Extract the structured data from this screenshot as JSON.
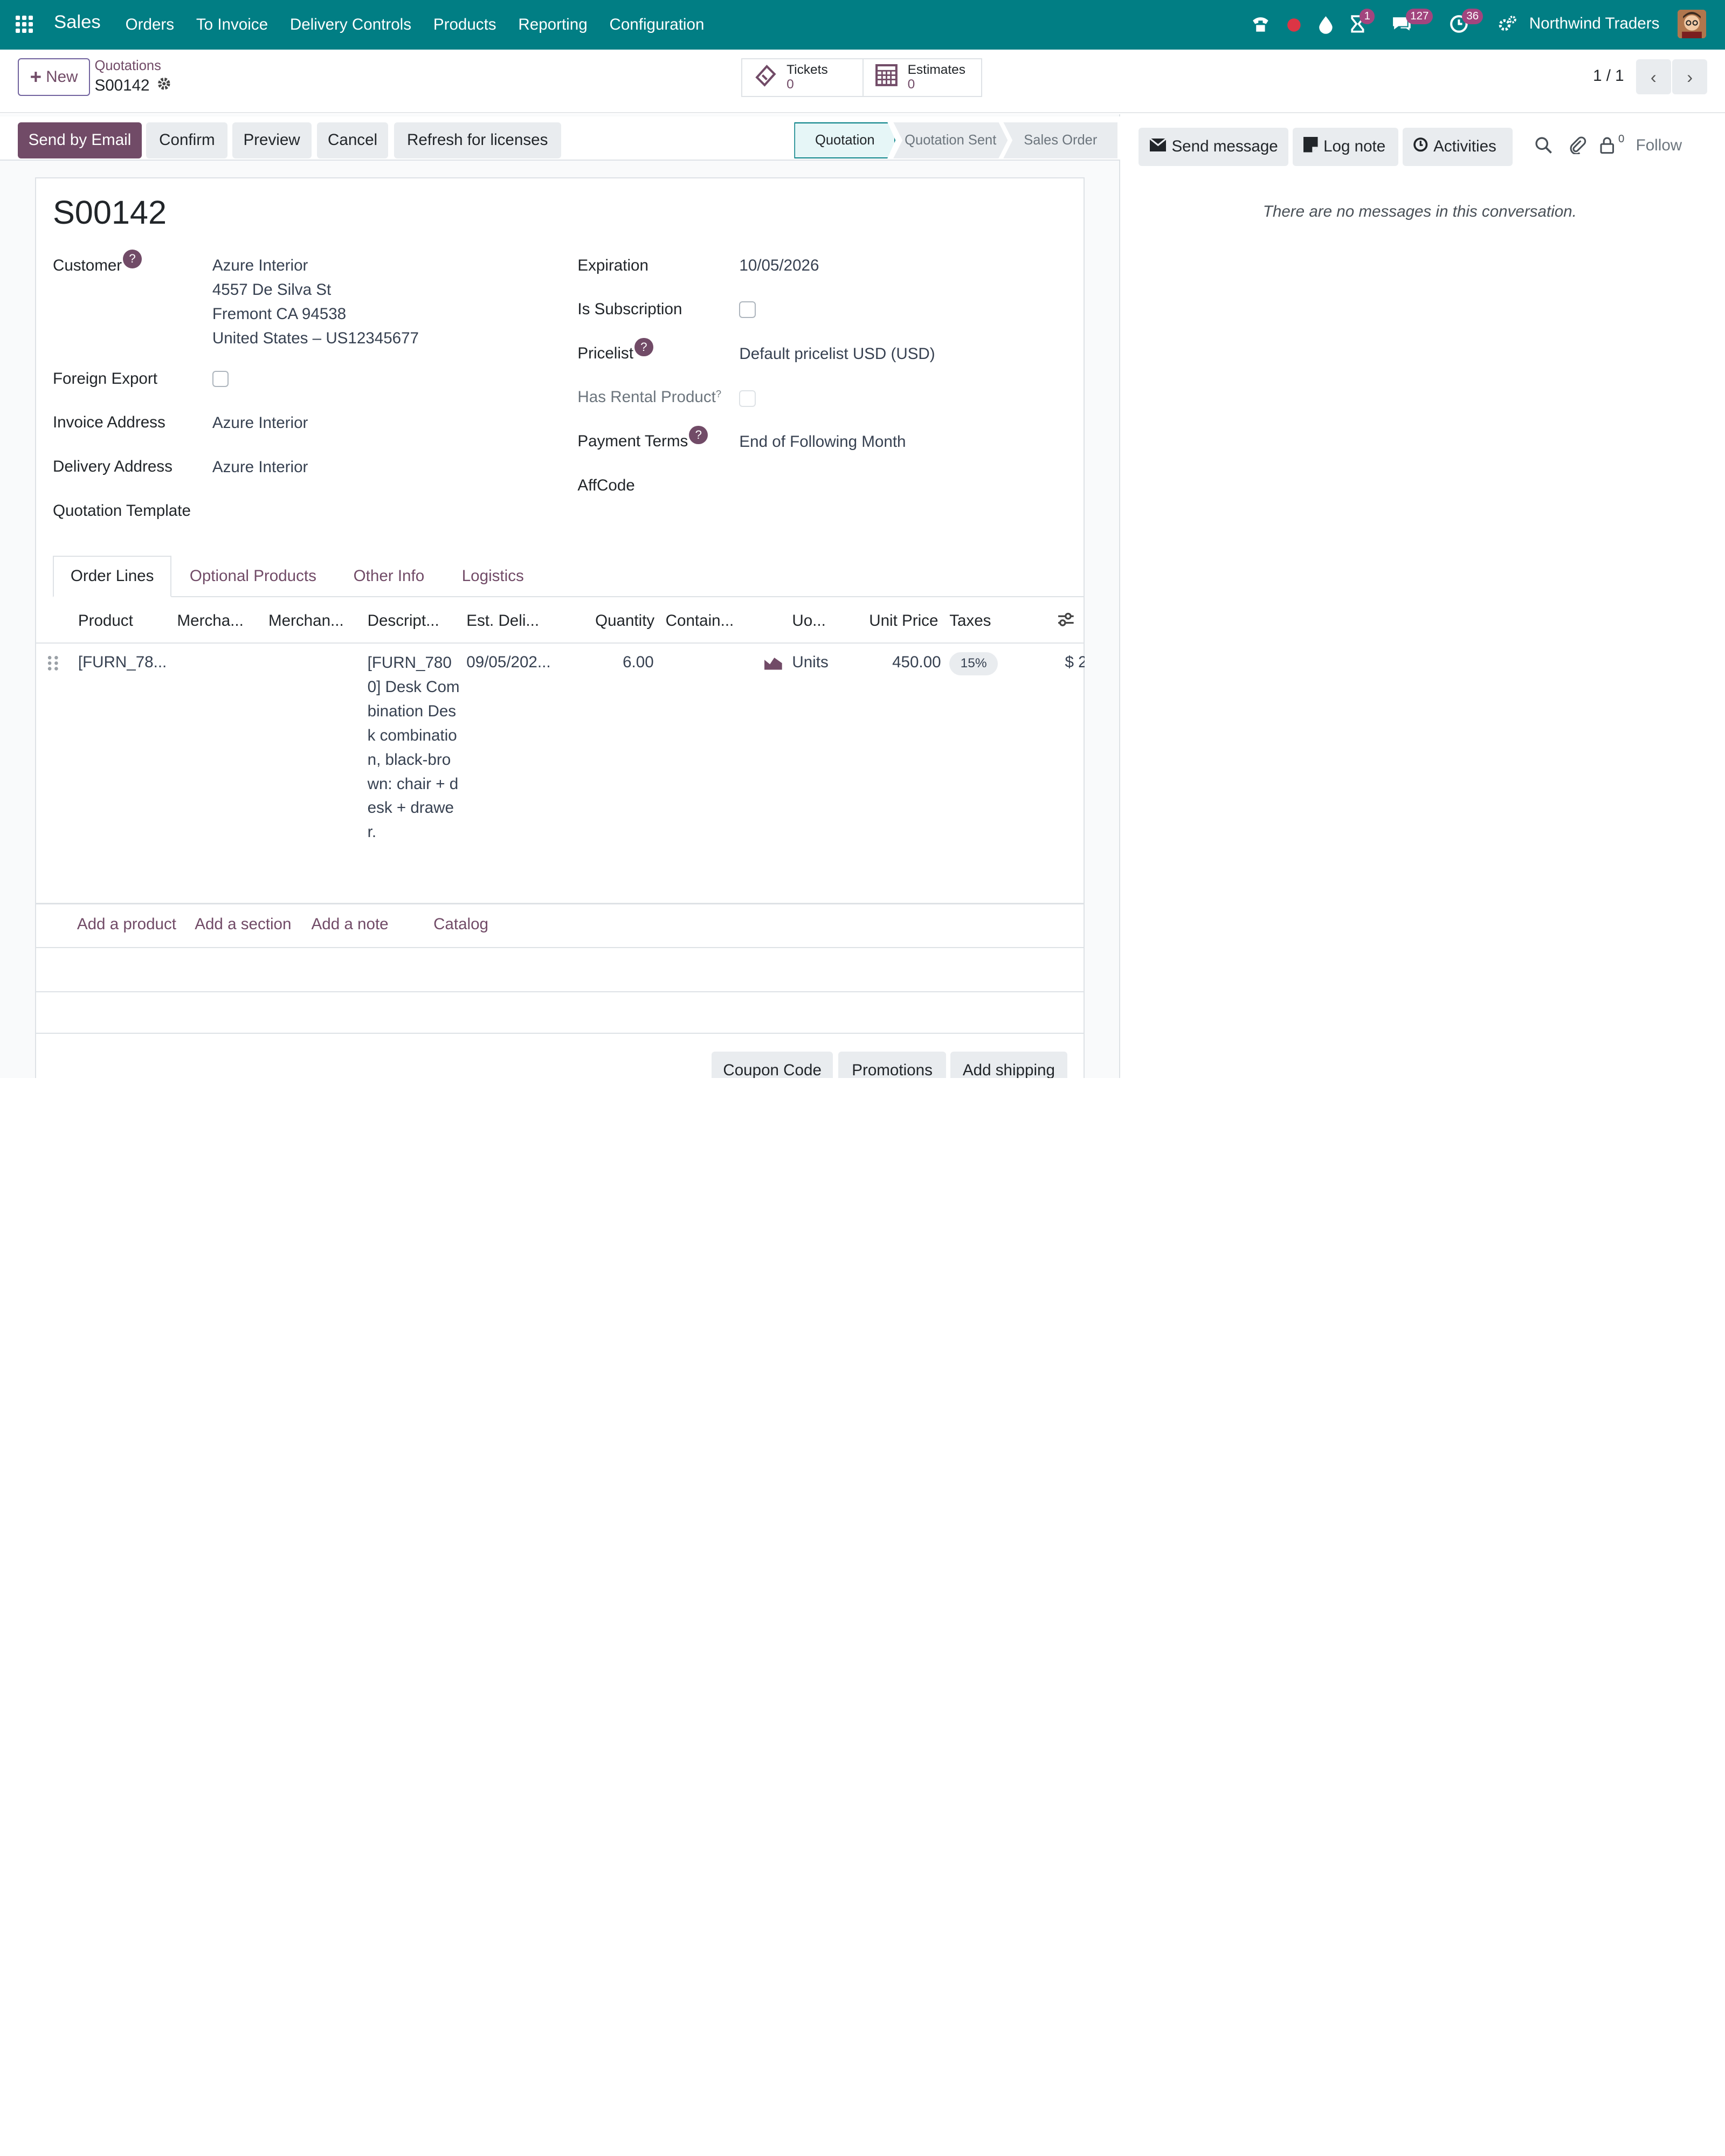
{
  "navbar": {
    "app_name": "Sales",
    "menu": [
      "Orders",
      "To Invoice",
      "Delivery Controls",
      "Products",
      "Reporting",
      "Configuration"
    ],
    "activity_badge": "1",
    "messages_badge": "127",
    "clock_badge": "36",
    "company": "Northwind Traders"
  },
  "control_panel": {
    "new_label": "New",
    "breadcrumb_parent": "Quotations",
    "breadcrumb_current": "S00142",
    "smart_buttons": [
      {
        "label": "Tickets",
        "value": "0",
        "icon": "ticket-icon"
      },
      {
        "label": "Estimates",
        "value": "0",
        "icon": "calculator-icon"
      }
    ],
    "pager": "1 / 1"
  },
  "statusbar": {
    "buttons": [
      "Send by Email",
      "Confirm",
      "Preview",
      "Cancel",
      "Refresh for licenses"
    ],
    "stages": [
      "Quotation",
      "Quotation Sent",
      "Sales Order"
    ],
    "active_stage": "Quotation"
  },
  "form": {
    "title": "S00142",
    "customer_label": "Customer",
    "customer_name": "Azure Interior",
    "customer_street": "4557 De Silva St",
    "customer_city": "Fremont CA 94538",
    "customer_country": "United States – US12345677",
    "foreign_export_label": "Foreign Export",
    "invoice_address_label": "Invoice Address",
    "invoice_address": "Azure Interior",
    "delivery_address_label": "Delivery Address",
    "delivery_address": "Azure Interior",
    "quotation_template_label": "Quotation Template",
    "expiration_label": "Expiration",
    "expiration": "10/05/2026",
    "is_subscription_label": "Is Subscription",
    "pricelist_label": "Pricelist",
    "pricelist": "Default pricelist USD  (USD)",
    "has_rental_label": "Has Rental Product",
    "payment_terms_label": "Payment Terms",
    "payment_terms": "End of Following Month",
    "affcode_label": "AffCode",
    "help_mark": "?"
  },
  "tabs": [
    "Order Lines",
    "Optional Products",
    "Other Info",
    "Logistics"
  ],
  "order_lines": {
    "columns": [
      "Product",
      "Mercha...",
      "Merchan...",
      "Descript...",
      "Est. Deli...",
      "Quantity",
      "Contain...",
      "Uo...",
      "Unit Price",
      "Taxes"
    ],
    "rows": [
      {
        "product": "[FURN_78...",
        "description": "[FURN_7800] Desk Combination\nDesk combination, black-brown: chair + desk + drawer.",
        "est_delivery": "09/05/202...",
        "quantity": "6.00",
        "uom": "Units",
        "unit_price": "450.00",
        "tax": "15%",
        "subtotal": "$ 2"
      }
    ],
    "add_links": [
      "Add a product",
      "Add a section",
      "Add a note",
      "Catalog"
    ]
  },
  "bottom_buttons": [
    "Coupon Code",
    "Promotions",
    "Add shipping"
  ],
  "chatter": {
    "send_message": "Send message",
    "log_note": "Log note",
    "activities": "Activities",
    "follower_count": "0",
    "follow": "Follow",
    "empty": "There are no messages in this conversation."
  },
  "colors": {
    "navbar": "#017e84",
    "primary": "#714b67",
    "badge": "#a2457e"
  }
}
